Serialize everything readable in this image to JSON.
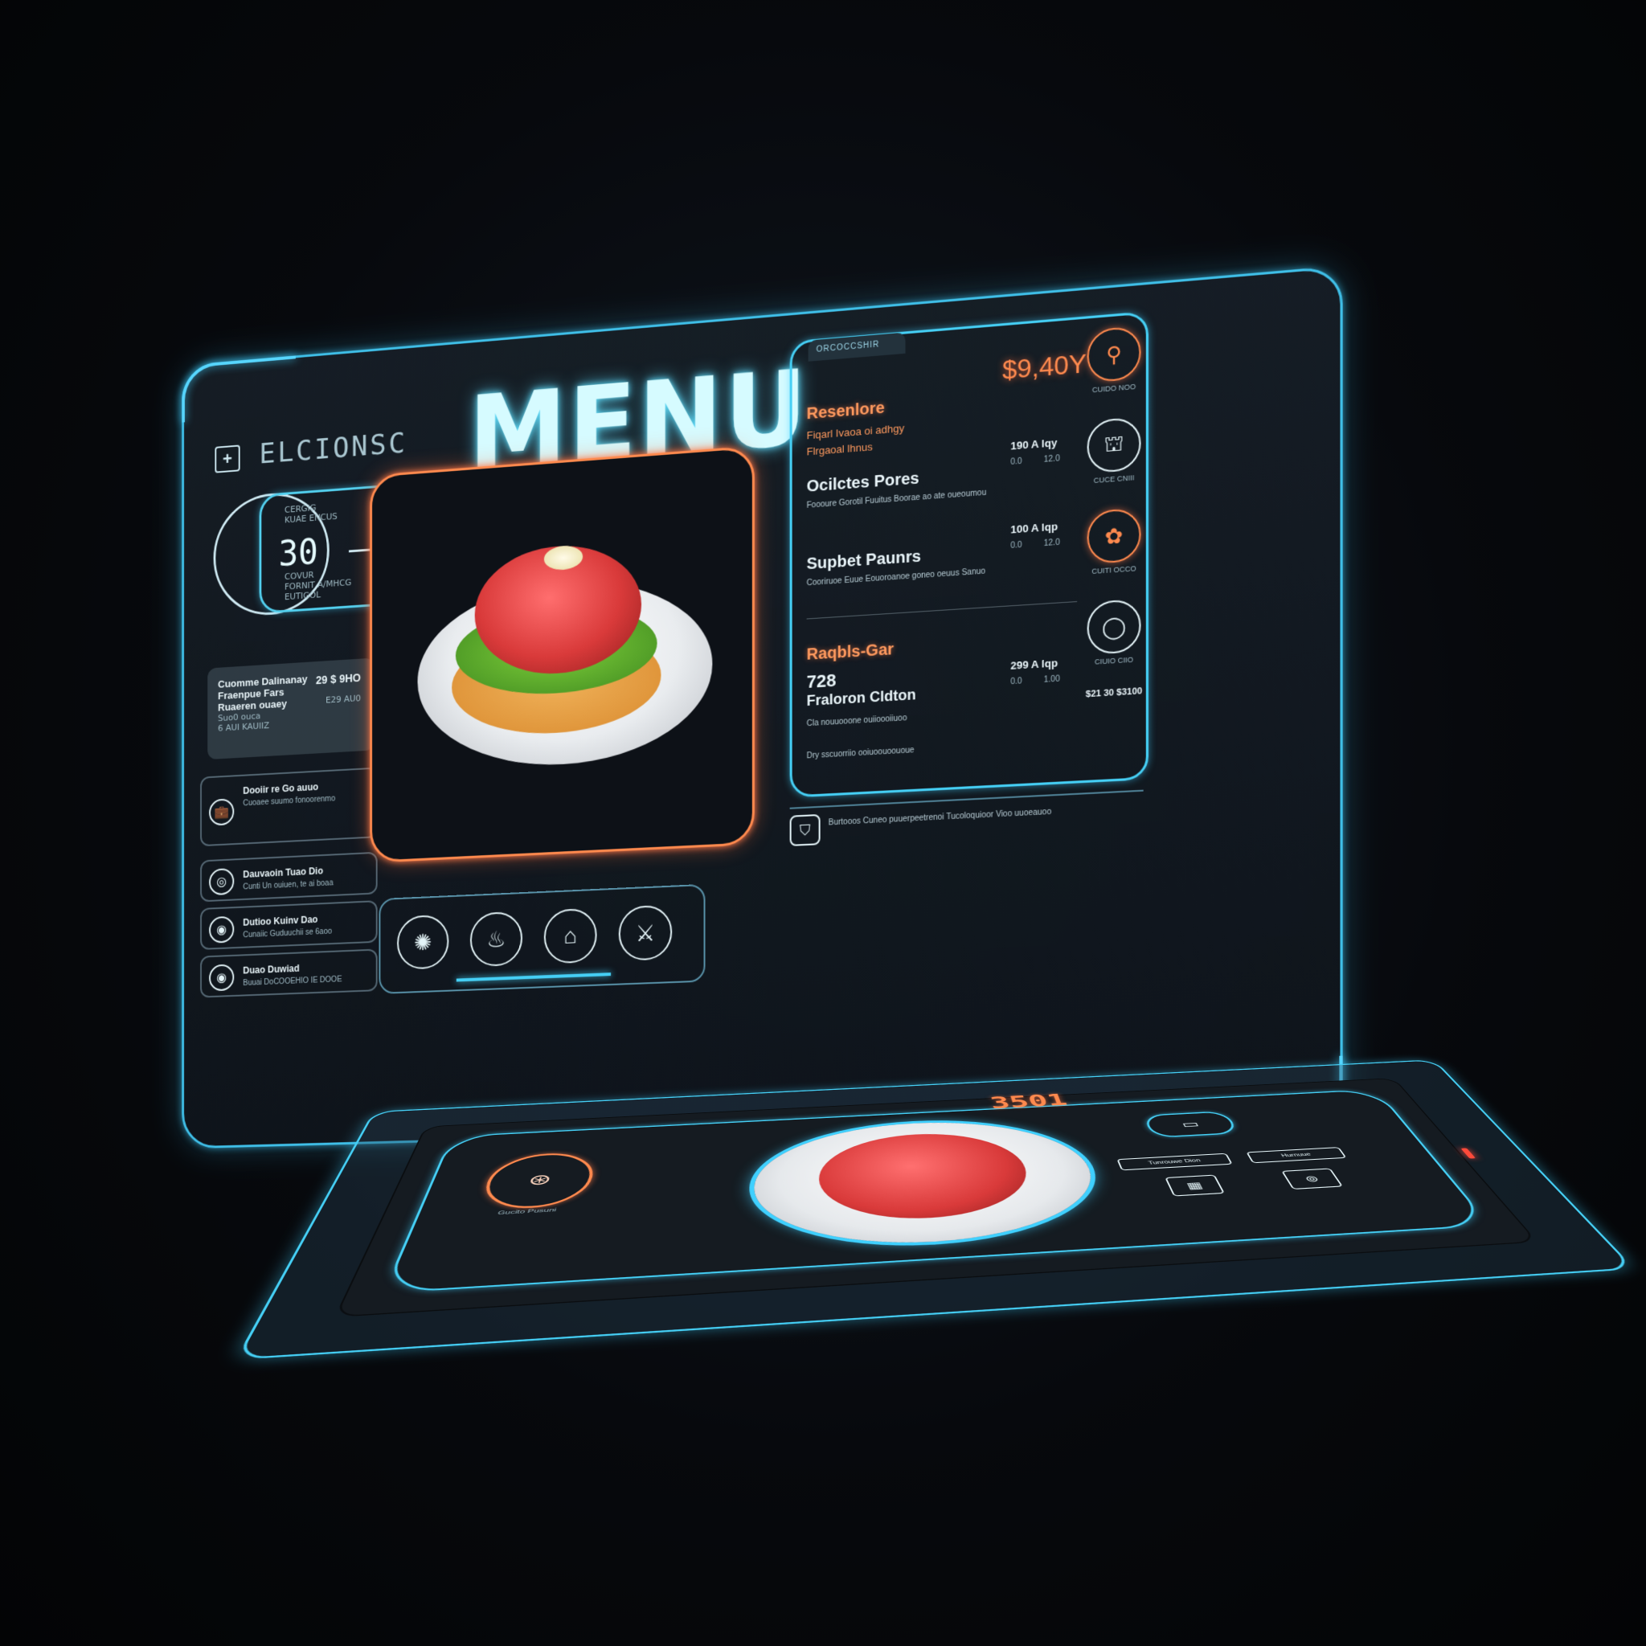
{
  "header": {
    "brand_icon": "plus-square-icon",
    "brand_name": "ELCIONSC",
    "title": "MENU"
  },
  "stats": {
    "label_top": "CERGIG\nKUAE ENCUS",
    "value": "30",
    "label_bottom": "COVUR\nFORNIT A/MHCG\nEUTIGOL"
  },
  "info_card": {
    "line1": "Cuomme Dalinanay",
    "line2": "Fraenpue Fars",
    "line3": "Ruaeren ouaey",
    "line4": "Suo0 ouca",
    "line5": "6 AUI KAUIIZ",
    "price": "29 $ 9HO",
    "price_sub": "E29 AU0"
  },
  "side_items": [
    {
      "icon": "briefcase-icon",
      "glyph": "💼",
      "label": "Dooiir re Go auuo",
      "sub": "Cuoaee suumo fonoorenmo"
    },
    {
      "icon": "spiral-icon",
      "glyph": "◎",
      "label": "Dauvaoin Tuao Dio",
      "sub": "Cunti Un ouiuen, te ai boaa"
    },
    {
      "icon": "swirl-icon",
      "glyph": "◉",
      "label": "Dutioo Kuinv Dao",
      "sub": "Cunaiic Guduuchii se 6aoo"
    },
    {
      "icon": "target-icon",
      "glyph": "◉",
      "label": "Duao Duwiad",
      "sub": "Buuai DoCOOEHIO IE DOOE"
    }
  ],
  "icon_bar": [
    {
      "icon": "sparkle-icon",
      "glyph": "✺"
    },
    {
      "icon": "drumstick-icon",
      "glyph": "♨"
    },
    {
      "icon": "cloche-icon",
      "glyph": "⌂"
    },
    {
      "icon": "knife-icon",
      "glyph": "⚔"
    }
  ],
  "price_list": {
    "tab": "ORCOCCSHIR",
    "big_price": "$9,40Y",
    "sections": [
      {
        "name": "Resenlore",
        "orange": true,
        "sub1": "Fiqarl Ivaoa oi adhgy",
        "sub2": "Flrgaoal lhnus"
      },
      {
        "name": "Ocilctes Pores",
        "orange": false,
        "desc": "Foooure Gorotil Fuuitus Boorae ao ate oueoumou",
        "price": "190 A lqy",
        "p1": "0.0",
        "p2": "12.0"
      },
      {
        "name": "Supbet Paunrs",
        "orange": false,
        "desc": "Cooriruoe Euue Eouoroanoe goneo oeuus Sanuo",
        "price": "100 A lqp",
        "p1": "0.0",
        "p2": "12.0"
      },
      {
        "name": "Raqbls-Gar",
        "orange": true,
        "num": "728",
        "sub": "Fraloron Cldton",
        "desc": "Cla nouuooone ouiioooiiuoo",
        "price": "299 A lqp",
        "p1": "0.0",
        "p2": "1.00"
      }
    ],
    "notes": "Dry sscuorriio ooiuoouoououe"
  },
  "icon_column": [
    {
      "icon": "spoon-icon",
      "glyph": "⚲",
      "label": "CUIDO NOO",
      "orange": true
    },
    {
      "icon": "cloche-icon",
      "glyph": "⛫",
      "label": "CUCE CNIII",
      "orange": false
    },
    {
      "icon": "brain-dish-icon",
      "glyph": "✿",
      "label": "CUITI OCCO",
      "orange": true
    },
    {
      "icon": "circle-icon",
      "glyph": "◯",
      "label": "CIUIO CIIO",
      "orange": false
    }
  ],
  "col_price": "$21 30 $3100",
  "footer": {
    "icon": "shield-icon",
    "glyph": "⛉",
    "text": "Burtooos Cuneo puuerpeetrenoi Tucoloquioor Vioo uuoeauoo"
  },
  "tray": {
    "code": "3501",
    "ring_icon": "dish-icon",
    "ring_glyph": "⊛",
    "ring_label": "Gucito Pusuni",
    "btn_icon": "tray-icon",
    "btn_glyph": "▭",
    "pill1": "Tunrouwe Dion",
    "pill2": "Hurnuue",
    "sq1_icon": "grid-icon",
    "sq1_glyph": "▦",
    "sq2_icon": "wifi-icon",
    "sq2_glyph": "⊚"
  },
  "colors": {
    "accent_cyan": "#45cff5",
    "accent_orange": "#ff8a4e",
    "background": "#07090d"
  }
}
